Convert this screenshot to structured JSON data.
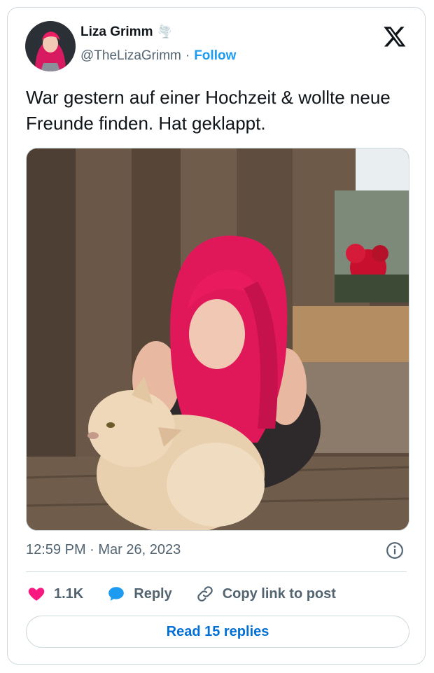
{
  "author": {
    "name": "Liza Grimm",
    "name_emoji": "🌪️",
    "handle": "@TheLizaGrimm",
    "separator": "·",
    "follow_label": "Follow"
  },
  "tweet": {
    "text": "War gestern auf einer Hochzeit & wollte neue Freunde finden. Hat geklappt.",
    "timestamp": "12:59 PM · Mar 26, 2023"
  },
  "actions": {
    "likes": "1.1K",
    "reply_label": "Reply",
    "copy_label": "Copy link to post"
  },
  "read_replies_label": "Read 15 replies",
  "colors": {
    "like": "#f91880",
    "reply": "#1d9bf0",
    "link_blue": "#006fd6",
    "muted": "#536471",
    "hair": "#e0185a"
  },
  "icons": [
    "x-logo-icon",
    "info-icon",
    "heart-icon",
    "speech-bubble-icon",
    "link-icon"
  ]
}
